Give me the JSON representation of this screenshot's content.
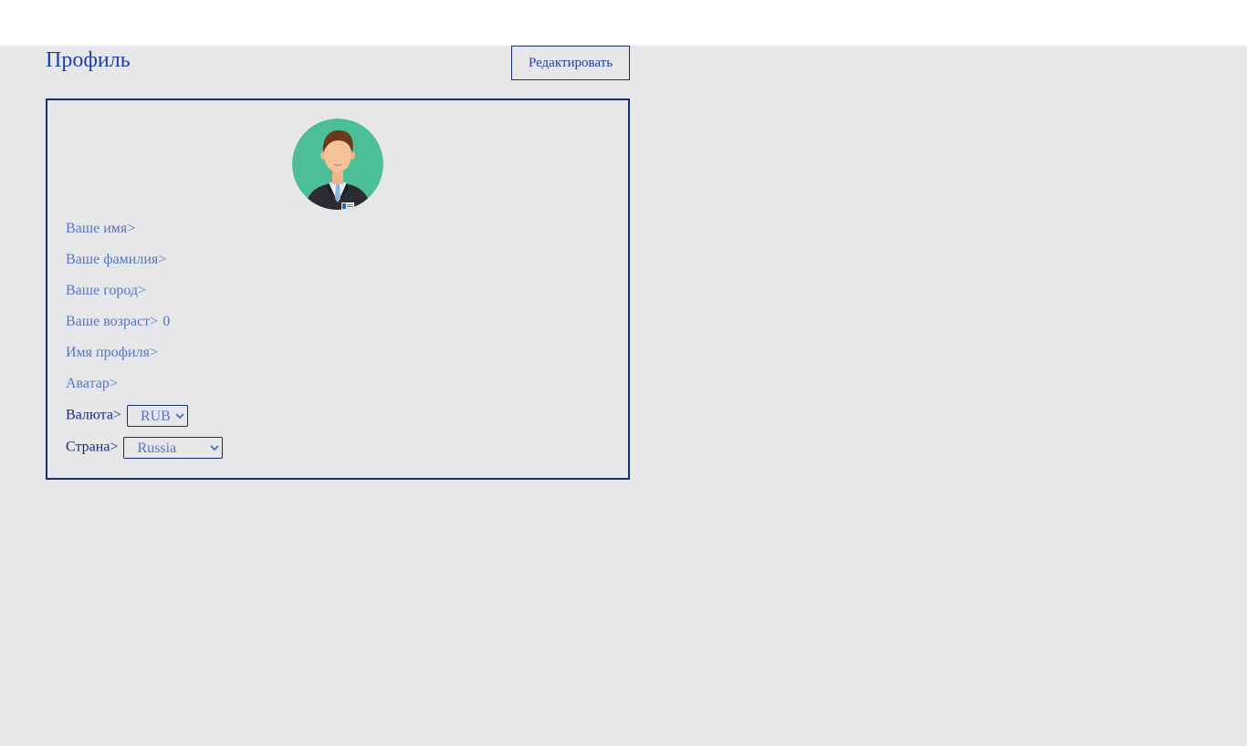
{
  "header": {
    "title": "Профиль",
    "edit_label": "Редактировать"
  },
  "profile": {
    "avatar_icon": "user-avatar-icon",
    "fields": {
      "first_name": {
        "label": "Ваше имя>",
        "value": ""
      },
      "last_name": {
        "label": "Ваше фамилия>",
        "value": ""
      },
      "city": {
        "label": "Ваше город>",
        "value": ""
      },
      "age": {
        "label": "Ваше возраст>",
        "value": "0"
      },
      "profile_name": {
        "label": "Имя профиля>",
        "value": ""
      },
      "avatar": {
        "label": "Аватар>",
        "value": ""
      }
    },
    "currency": {
      "label": "Валюта>",
      "selected": "RUB"
    },
    "country": {
      "label": "Страна>",
      "selected": "Russia"
    }
  },
  "colors": {
    "accent": "#1f3fa8",
    "border": "#1a2a78",
    "label": "#5577c4",
    "background": "#e7e7ea",
    "avatar_bg": "#4dbf98"
  }
}
